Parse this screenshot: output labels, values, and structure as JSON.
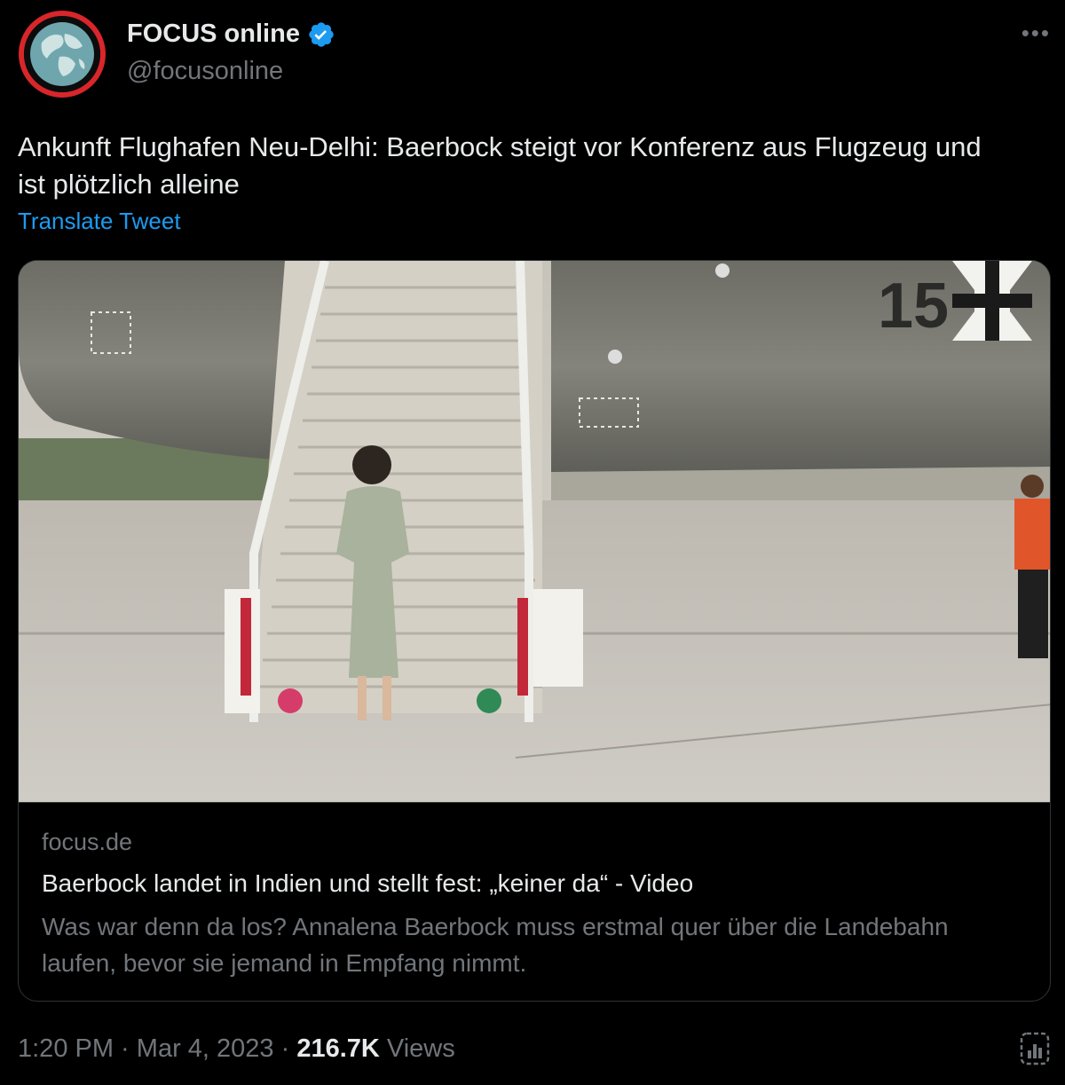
{
  "author": {
    "display_name": "FOCUS online",
    "handle": "@focusonline",
    "verified": true,
    "avatar_icon": "globe-icon",
    "verified_icon": "verified-badge-icon",
    "more_icon": "more-horizontal-icon"
  },
  "tweet": {
    "text": "Ankunft Flughafen Neu-Delhi: Baerbock steigt vor Konferenz aus Flugzeug und ist plötzlich alleine",
    "translate_label": "Translate Tweet"
  },
  "card": {
    "aircraft_number": "15",
    "domain": "focus.de",
    "title": "Baerbock landet in Indien und stellt fest: „keiner da“ - Video",
    "description": "Was war denn da los? Annalena Baerbock muss erstmal quer über die Landebahn laufen, bevor sie jemand in Empfang nimmt."
  },
  "meta": {
    "time": "1:20 PM",
    "separator": " · ",
    "date": "Mar 4, 2023",
    "views_count": "216.7K",
    "views_label": " Views",
    "analytics_icon": "analytics-icon"
  },
  "colors": {
    "background": "#000000",
    "text": "#e7e9ea",
    "muted": "#71767b",
    "link": "#1d9bf0",
    "verified": "#1d9bf0",
    "avatar_ring": "#d8262b"
  }
}
